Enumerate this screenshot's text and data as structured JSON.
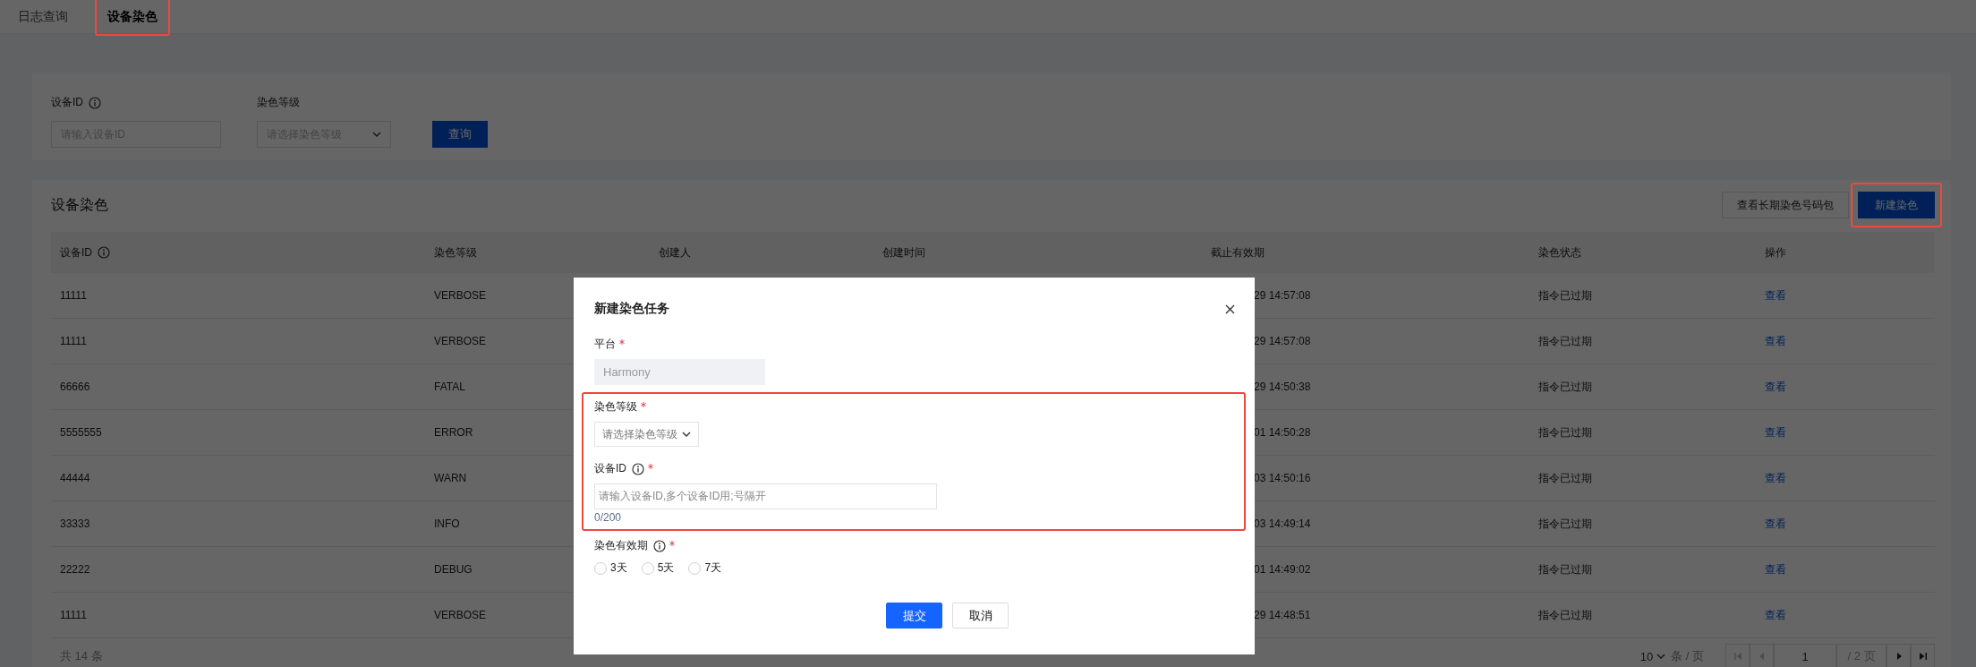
{
  "tabs": [
    {
      "label": "日志查询",
      "selected": false,
      "highlighted": false
    },
    {
      "label": "设备染色",
      "selected": true,
      "highlighted": true
    }
  ],
  "filter": {
    "fields": [
      {
        "kind": "input",
        "label": "设备ID",
        "info": true,
        "placeholder": "请输入设备ID"
      },
      {
        "kind": "select",
        "label": "染色等级",
        "info": false,
        "placeholder": "请选择染色等级"
      }
    ],
    "query_button": "查询"
  },
  "table_card": {
    "title": "设备染色",
    "buttons": [
      {
        "label": "查看长期染色号码包",
        "primary": false,
        "highlighted": false
      },
      {
        "label": "新建染色",
        "primary": true,
        "highlighted": true
      }
    ],
    "columns": [
      {
        "label": "设备ID",
        "info": true
      },
      {
        "label": "染色等级",
        "info": false
      },
      {
        "label": "创建人",
        "info": false
      },
      {
        "label": "创建时间",
        "info": false
      },
      {
        "label": "截止有效期",
        "info": false
      },
      {
        "label": "染色状态",
        "info": false
      },
      {
        "label": "操作",
        "info": false
      }
    ],
    "rows": [
      {
        "device_id": "11111",
        "level": "VERBOSE",
        "deadline": "29 14:57:08",
        "status": "指令已过期",
        "action": "查看"
      },
      {
        "device_id": "11111",
        "level": "VERBOSE",
        "deadline": "29 14:57:08",
        "status": "指令已过期",
        "action": "查看"
      },
      {
        "device_id": "66666",
        "level": "FATAL",
        "deadline": "29 14:50:38",
        "status": "指令已过期",
        "action": "查看"
      },
      {
        "device_id": "5555555",
        "level": "ERROR",
        "deadline": "01 14:50:28",
        "status": "指令已过期",
        "action": "查看"
      },
      {
        "device_id": "44444",
        "level": "WARN",
        "deadline": "03 14:50:16",
        "status": "指令已过期",
        "action": "查看"
      },
      {
        "device_id": "33333",
        "level": "INFO",
        "deadline": "03 14:49:14",
        "status": "指令已过期",
        "action": "查看"
      },
      {
        "device_id": "22222",
        "level": "DEBUG",
        "deadline": "01 14:49:02",
        "status": "指令已过期",
        "action": "查看"
      },
      {
        "device_id": "11111",
        "level": "VERBOSE",
        "deadline": "29 14:48:51",
        "status": "指令已过期",
        "action": "查看"
      }
    ],
    "total": "共 14 条",
    "pagination": {
      "page_size": "10",
      "per_page_label": "条 / 页",
      "page": "1",
      "page_count": "/ 2 页"
    }
  },
  "modal": {
    "title": "新建染色任务",
    "fields": [
      {
        "kind": "disabled_input",
        "label": "平台",
        "info": false,
        "required": true,
        "highlighted": false,
        "value": "Harmony"
      },
      {
        "kind": "select",
        "label": "染色等级",
        "info": false,
        "required": true,
        "highlighted": true,
        "placeholder": "请选择染色等级"
      },
      {
        "kind": "textarea",
        "label": "设备ID",
        "info": true,
        "required": true,
        "highlighted": true,
        "placeholder": "请输入设备ID,多个设备ID用;号隔开",
        "counter": "0/200"
      },
      {
        "kind": "radio",
        "label": "染色有效期",
        "info": true,
        "required": true,
        "highlighted": false,
        "options": [
          {
            "label": "3天",
            "selected": false
          },
          {
            "label": "5天",
            "selected": false
          },
          {
            "label": "7天",
            "selected": false
          }
        ]
      }
    ],
    "buttons": [
      {
        "label": "提交",
        "primary": true
      },
      {
        "label": "取消",
        "primary": false
      }
    ]
  }
}
